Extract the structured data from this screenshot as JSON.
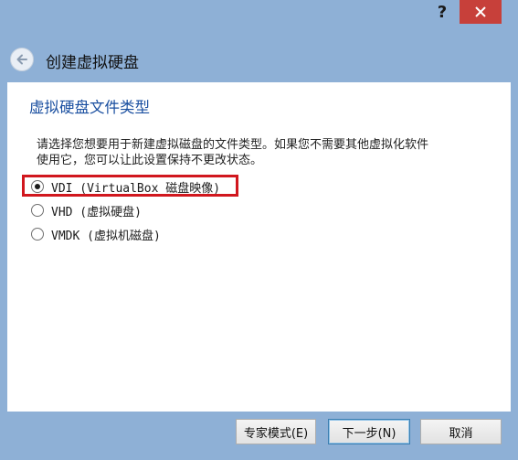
{
  "titlebar": {
    "help_label": "?"
  },
  "header": {
    "title": "创建虚拟硬盘"
  },
  "section": {
    "title": "虚拟硬盘文件类型"
  },
  "description": {
    "line1": "请选择您想要用于新建虚拟磁盘的文件类型。如果您不需要其他虚拟化软件",
    "line2": "使用它，您可以让此设置保持不更改状态。"
  },
  "options": [
    {
      "label": "VDI (VirtualBox 磁盘映像)",
      "selected": true
    },
    {
      "label": "VHD (虚拟硬盘)",
      "selected": false
    },
    {
      "label": "VMDK (虚拟机磁盘)",
      "selected": false
    }
  ],
  "buttons": {
    "expert": "专家模式(E)",
    "next": "下一步(N)",
    "cancel": "取消"
  },
  "colors": {
    "highlight": "#d1171e",
    "section_title": "#1a4fa0",
    "close": "#c7403a",
    "frame": "#8eb0d6"
  },
  "icons": {
    "back": "back-arrow-icon",
    "close": "close-icon"
  }
}
